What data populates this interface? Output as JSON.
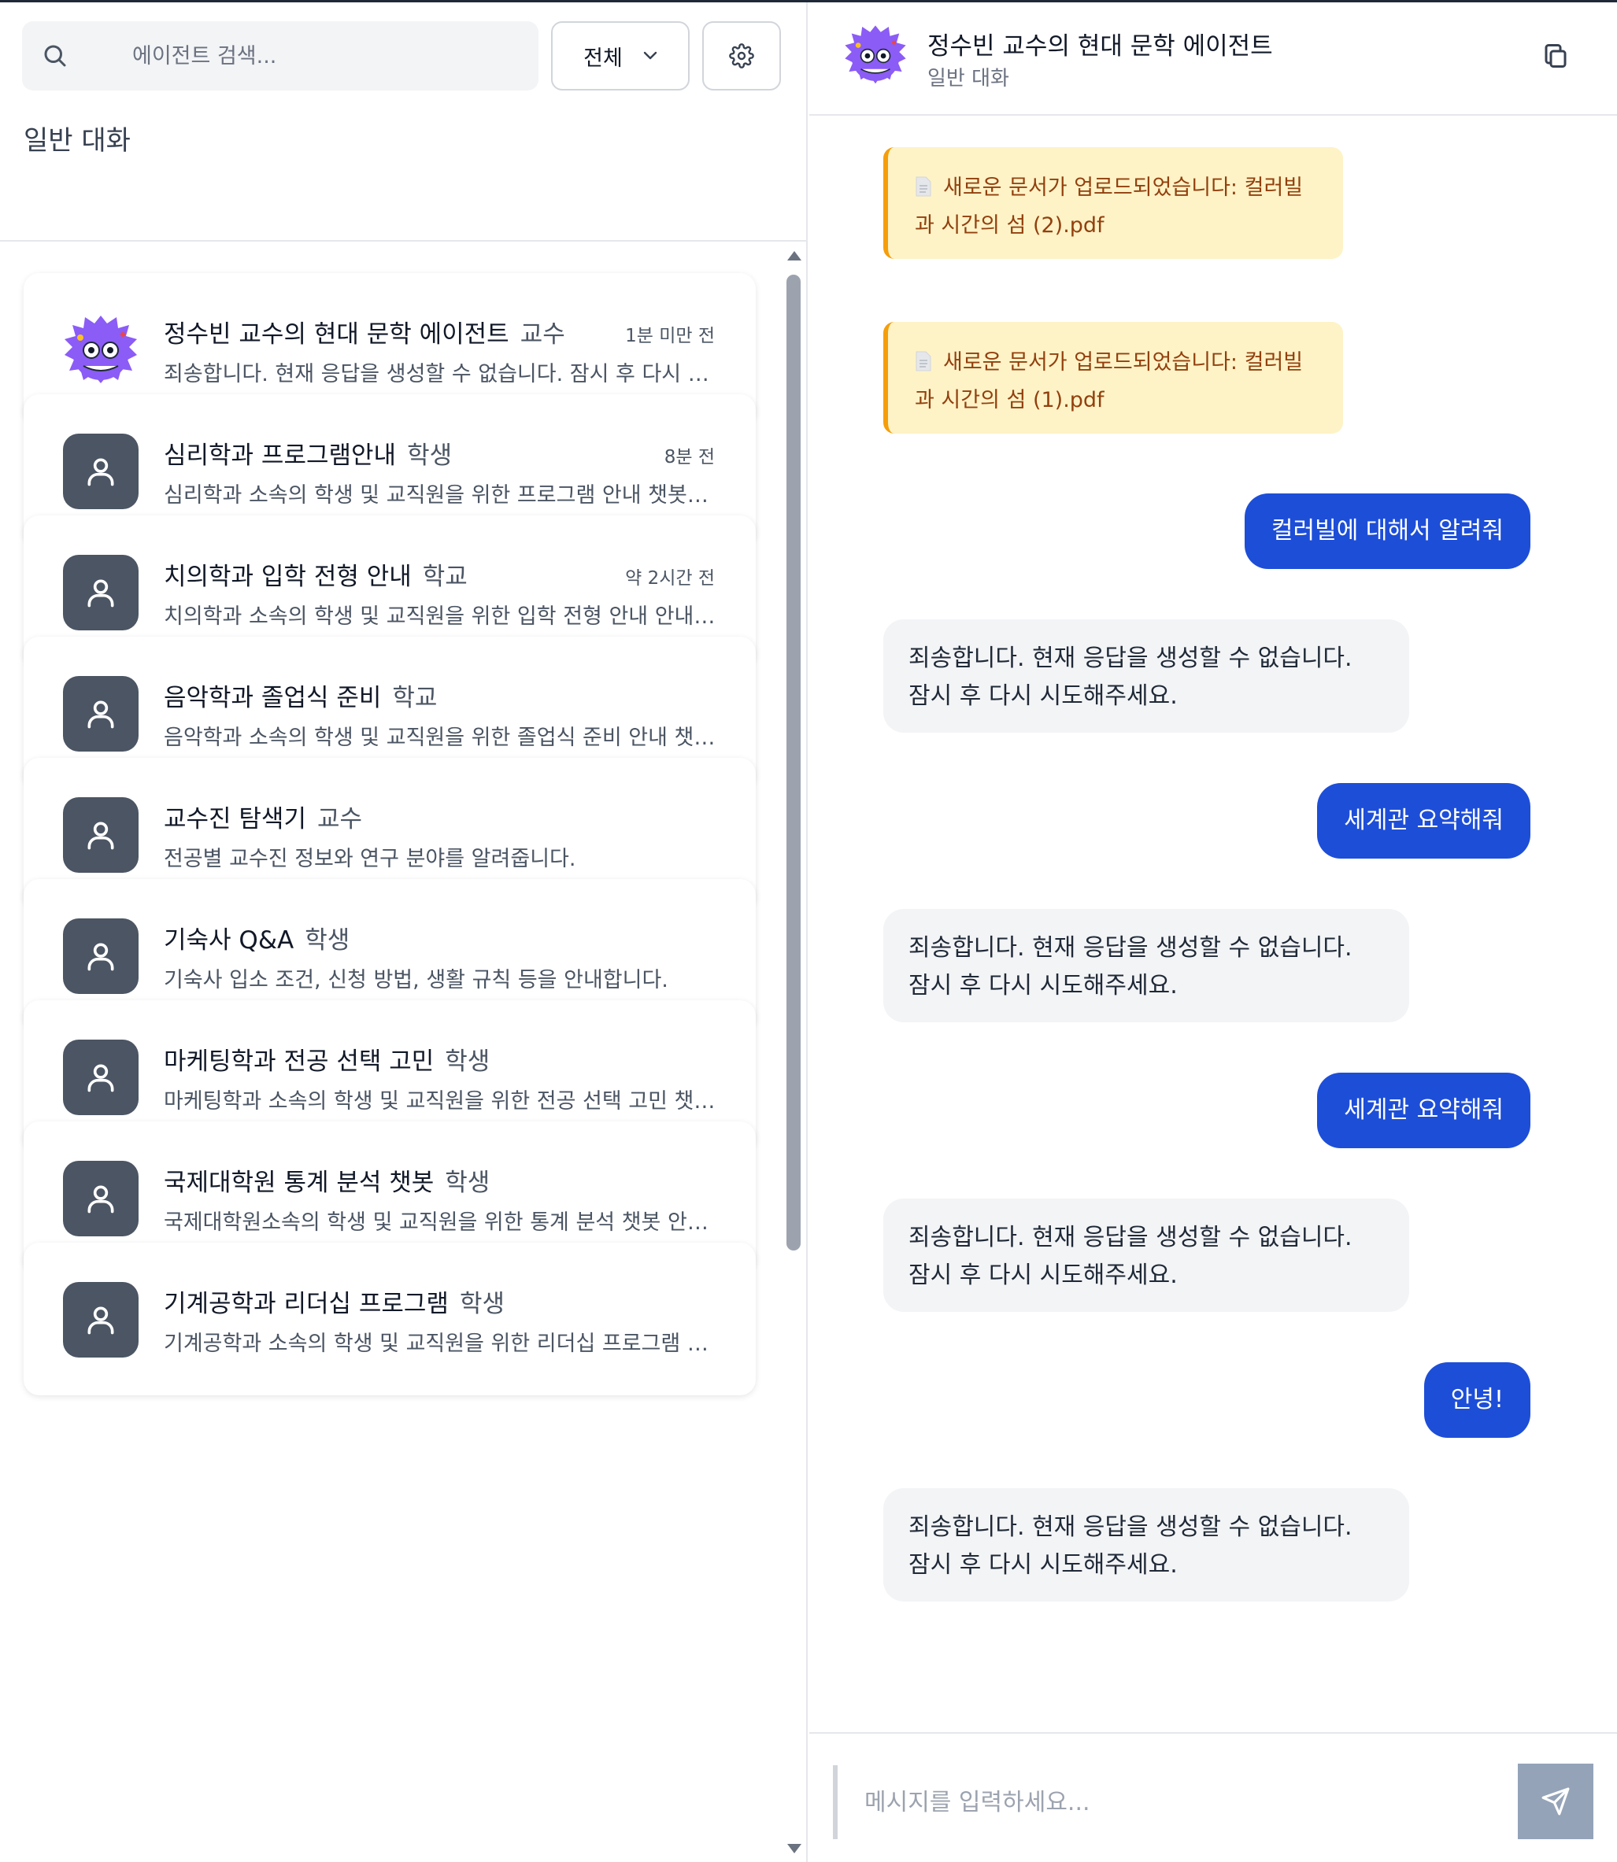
{
  "sidebar": {
    "search_placeholder": "에이전트 검색...",
    "filter_label": "전체",
    "section_title": "일반 대화",
    "agents": [
      {
        "name": "정수빈 교수의 현대 문학 에이전트",
        "role": "교수",
        "time": "1분 미만 전",
        "desc": "죄송합니다. 현재 응답을 생성할 수 없습니다. 잠시 후 다시 시도해주세요.",
        "avatar": "monster-avatar"
      },
      {
        "name": "심리학과 프로그램안내",
        "role": "학생",
        "time": "8분 전",
        "desc": "심리학과 소속의 학생 및 교직원을 위한 프로그램 안내 챗봇입니다.",
        "avatar": "user-icon"
      },
      {
        "name": "치의학과 입학 전형 안내",
        "role": "학교",
        "time": "약 2시간 전",
        "desc": "치의학과 소속의 학생 및 교직원을 위한 입학 전형 안내 안내입니다.",
        "avatar": "user-icon"
      },
      {
        "name": "음악학과 졸업식 준비",
        "role": "학교",
        "time": "",
        "desc": "음악학과 소속의 학생 및 교직원을 위한 졸업식 준비 안내 챗봇입니다.",
        "avatar": "user-icon"
      },
      {
        "name": "교수진 탐색기",
        "role": "교수",
        "time": "",
        "desc": "전공별 교수진 정보와 연구 분야를 알려줍니다.",
        "avatar": "user-icon"
      },
      {
        "name": "기숙사 Q&A",
        "role": "학생",
        "time": "",
        "desc": "기숙사 입소 조건, 신청 방법, 생활 규칙 등을 안내합니다.",
        "avatar": "user-icon"
      },
      {
        "name": "마케팅학과 전공 선택 고민",
        "role": "학생",
        "time": "",
        "desc": "마케팅학과 소속의 학생 및 교직원을 위한 전공 선택 고민 챗봇입니다.",
        "avatar": "user-icon"
      },
      {
        "name": "국제대학원 통계 분석 챗봇",
        "role": "학생",
        "time": "",
        "desc": "국제대학원소속의 학생 및 교직원을 위한 통계 분석 챗봇 안내입니다.",
        "avatar": "user-icon"
      },
      {
        "name": "기계공학과 리더십 프로그램",
        "role": "학생",
        "time": "",
        "desc": "기계공학과 소속의 학생 및 교직원을 위한 리더십 프로그램 안내입니다.",
        "avatar": "user-icon"
      }
    ]
  },
  "chat": {
    "title": "정수빈 교수의 현대 문학 에이전트",
    "subtitle": "일반 대화",
    "messages": [
      {
        "type": "notice",
        "line1": "새로운 문서가 업로드되었습니다: 컬러빌",
        "line2": "과 시간의 섬 (2).pdf"
      },
      {
        "type": "notice",
        "line1": "새로운 문서가 업로드되었습니다: 컬러빌",
        "line2": "과 시간의 섬 (1).pdf"
      },
      {
        "type": "user",
        "text": "컬러빌에 대해서 알려줘"
      },
      {
        "type": "bot",
        "line1": "죄송합니다. 현재 응답을 생성할 수 없습니다.",
        "line2": "잠시 후 다시 시도해주세요."
      },
      {
        "type": "user",
        "text": "세계관 요약해줘"
      },
      {
        "type": "bot",
        "line1": "죄송합니다. 현재 응답을 생성할 수 없습니다.",
        "line2": "잠시 후 다시 시도해주세요."
      },
      {
        "type": "user",
        "text": "세계관 요약해줘"
      },
      {
        "type": "bot",
        "line1": "죄송합니다. 현재 응답을 생성할 수 없습니다.",
        "line2": "잠시 후 다시 시도해주세요."
      },
      {
        "type": "user",
        "text": "안녕!"
      },
      {
        "type": "bot",
        "line1": "죄송합니다. 현재 응답을 생성할 수 없습니다.",
        "line2": "잠시 후 다시 시도해주세요."
      }
    ],
    "input_placeholder": "메시지를 입력하세요..."
  },
  "colors": {
    "accent": "#1d4ed8",
    "notice_bg": "#fef3c7",
    "notice_border": "#f59e0b",
    "avatar_bg": "#4b5563",
    "monster": "#8b5cf6"
  }
}
